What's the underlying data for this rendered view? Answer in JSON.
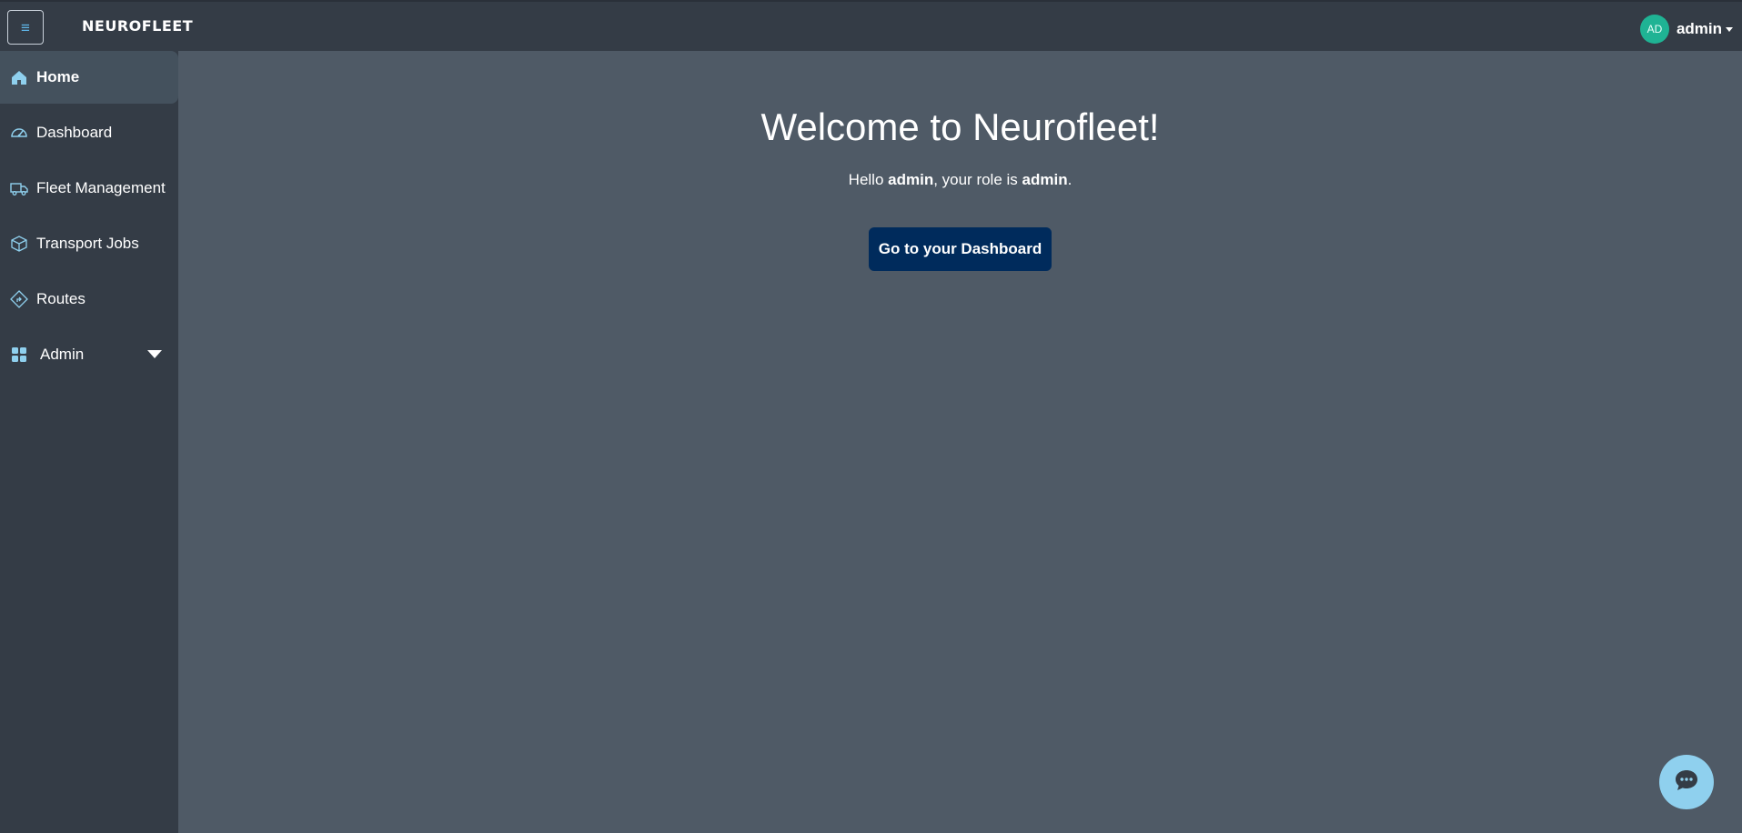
{
  "header": {
    "menu_glyph": "≡",
    "logo": "NEUROFLEET",
    "avatar_initials": "AD",
    "username": "admin"
  },
  "sidebar": {
    "items": [
      {
        "label": "Home",
        "icon": "home-icon",
        "active": true
      },
      {
        "label": "Dashboard",
        "icon": "speedometer-icon"
      },
      {
        "label": "Fleet Management",
        "icon": "truck-icon"
      },
      {
        "label": "Transport Jobs",
        "icon": "box-icon"
      },
      {
        "label": "Routes",
        "icon": "route-sign-icon"
      },
      {
        "label": "Admin",
        "icon": "grid-icon",
        "has_dropdown": true
      }
    ]
  },
  "main": {
    "title": "Welcome to Neurofleet!",
    "hello_prefix": "Hello ",
    "hello_user": "admin",
    "hello_middle": ", your role is ",
    "hello_role": "admin",
    "hello_suffix": ".",
    "dashboard_button": "Go to your Dashboard"
  },
  "chat": {
    "icon": "chat-bubble-icon"
  },
  "colors": {
    "background": "#4f5a66",
    "sidebar": "#343c46",
    "accent": "#5fb6e8",
    "avatar": "#1fb394",
    "button": "#002b5c",
    "chat_fab": "#8fd0ee"
  }
}
